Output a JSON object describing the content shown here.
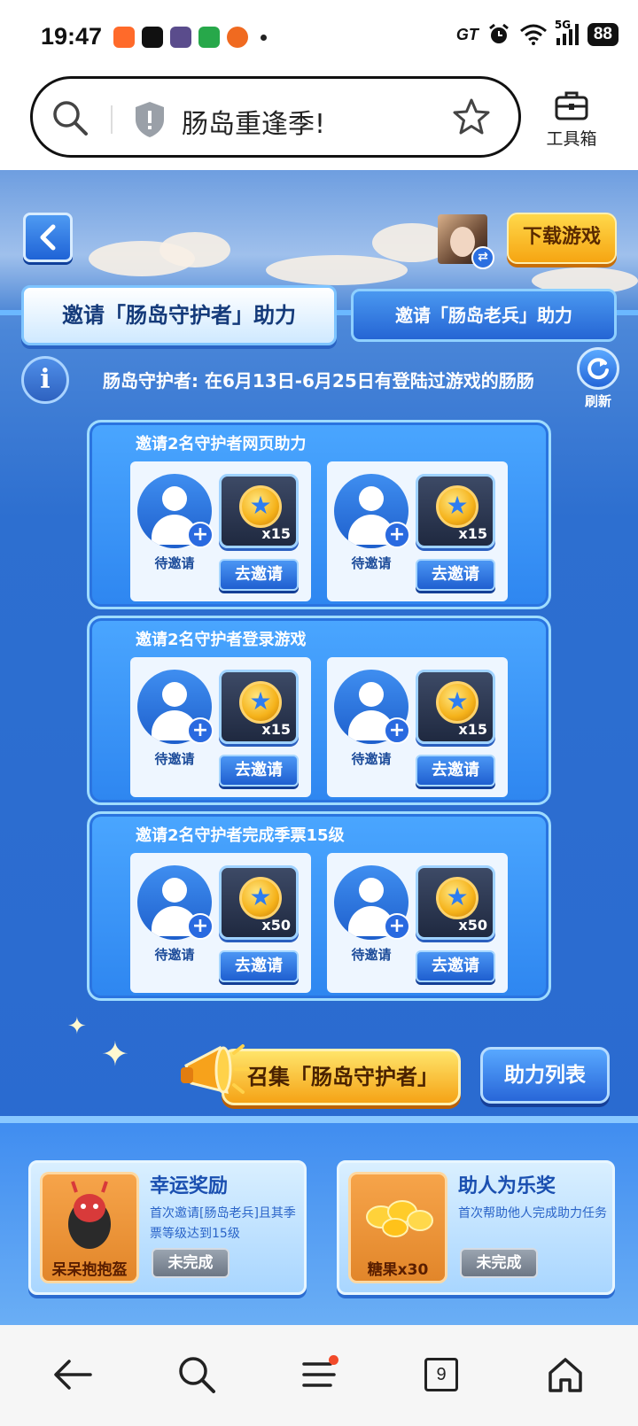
{
  "status_bar": {
    "time": "19:47",
    "network": "GT",
    "signal": "5G",
    "battery": "88"
  },
  "browser": {
    "page_title": "肠岛重逢季!",
    "toolbox_label": "工具箱"
  },
  "header": {
    "download_label": "下载游戏"
  },
  "tabs": [
    {
      "label": "邀请「肠岛守护者」助力",
      "active": true
    },
    {
      "label": "邀请「肠岛老兵」助力",
      "active": false
    }
  ],
  "info": {
    "text": "肠岛守护者: 在6月13日-6月25日有登陆过游戏的肠肠",
    "refresh_label": "刷新"
  },
  "panels": [
    {
      "title": "邀请2名守护者网页助力",
      "cards": [
        {
          "status": "待邀请",
          "reward_qty": "x15",
          "button": "去邀请"
        },
        {
          "status": "待邀请",
          "reward_qty": "x15",
          "button": "去邀请"
        }
      ]
    },
    {
      "title": "邀请2名守护者登录游戏",
      "cards": [
        {
          "status": "待邀请",
          "reward_qty": "x15",
          "button": "去邀请"
        },
        {
          "status": "待邀请",
          "reward_qty": "x15",
          "button": "去邀请"
        }
      ]
    },
    {
      "title": "邀请2名守护者完成季票15级",
      "cards": [
        {
          "status": "待邀请",
          "reward_qty": "x50",
          "button": "去邀请"
        },
        {
          "status": "待邀请",
          "reward_qty": "x50",
          "button": "去邀请"
        }
      ]
    }
  ],
  "actions": {
    "gather_label": "召集「肠岛守护者」",
    "help_list_label": "助力列表"
  },
  "rewards": [
    {
      "title": "幸运奖励",
      "desc": "首次邀请[肠岛老兵]且其季票等级达到15级",
      "item": "呆呆抱抱盔",
      "status": "未完成"
    },
    {
      "title": "助人为乐奖",
      "desc": "首次帮助他人完成助力任务",
      "item": "糖果x30",
      "status": "未完成"
    }
  ],
  "nav": {
    "tab_count": "9"
  },
  "colors": {
    "accent_blue": "#2a6ad0",
    "button_yellow": "#f6a512",
    "reward_orange": "#e2862a",
    "status_gray": "#6d7785"
  }
}
